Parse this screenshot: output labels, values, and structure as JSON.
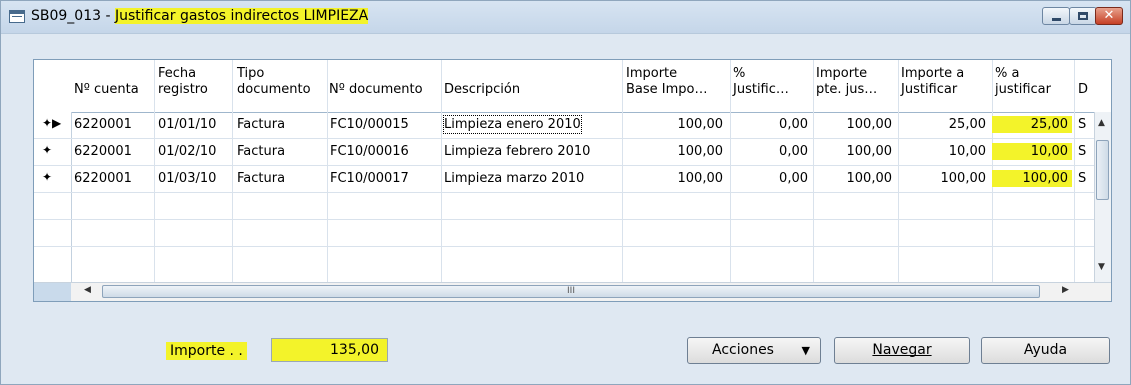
{
  "window": {
    "title_prefix": "SB09_013 - ",
    "title_highlight": "Justificar gastos indirectos LIMPIEZA",
    "minimize_label": "",
    "maximize_label": "",
    "close_label": "✕"
  },
  "table": {
    "headers": {
      "cuenta": "Nº cuenta",
      "fecha_l1": "Fecha",
      "fecha_l2": "registro",
      "tipo_l1": "Tipo",
      "tipo_l2": "documento",
      "ndoc": "Nº documento",
      "desc": "Descripción",
      "base_l1": "Importe",
      "base_l2": "Base Impo…",
      "pctj_l1": "%",
      "pctj_l2": "Justific…",
      "pte_l1": "Importe",
      "pte_l2": "pte. jus…",
      "aj_l1": "Importe a",
      "aj_l2": "Justificar",
      "pa_l1": "% a",
      "pa_l2": "justificar",
      "extra": "D"
    },
    "rows": [
      {
        "marker": "✦▶",
        "cuenta": "6220001",
        "fecha": "01/01/10",
        "tipo": "Factura",
        "ndoc": "FC10/00015",
        "desc": "Limpieza enero 2010",
        "base": "100,00",
        "pctj": "0,00",
        "pte": "100,00",
        "aj": "25,00",
        "pa": "25,00",
        "extra": "S"
      },
      {
        "marker": "✦",
        "cuenta": "6220001",
        "fecha": "01/02/10",
        "tipo": "Factura",
        "ndoc": "FC10/00016",
        "desc": "Limpieza febrero 2010",
        "base": "100,00",
        "pctj": "0,00",
        "pte": "100,00",
        "aj": "10,00",
        "pa": "10,00",
        "extra": "S"
      },
      {
        "marker": "✦",
        "cuenta": "6220001",
        "fecha": "01/03/10",
        "tipo": "Factura",
        "ndoc": "FC10/00017",
        "desc": "Limpieza marzo 2010",
        "base": "100,00",
        "pctj": "0,00",
        "pte": "100,00",
        "aj": "100,00",
        "pa": "100,00",
        "extra": "S"
      }
    ],
    "scroll_grip": "III"
  },
  "footer": {
    "importe_label": "Importe . .",
    "importe_value": "135,00",
    "acciones": "Acciones",
    "navegar": "Navegar",
    "ayuda": "Ayuda"
  },
  "colors": {
    "highlight": "#f3f32a",
    "window_bg": "#dfe8f2"
  },
  "icons": [
    "form-icon",
    "minimize-icon",
    "maximize-icon",
    "close-icon",
    "row-marker-icon",
    "dropdown-caret-icon",
    "scroll-arrow-icon"
  ]
}
